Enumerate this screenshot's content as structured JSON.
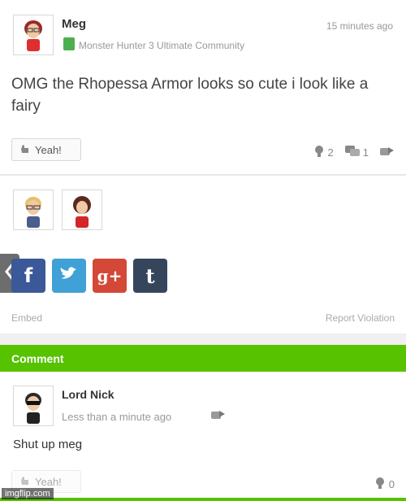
{
  "post": {
    "author": "Meg",
    "time": "15 minutes ago",
    "community": "Monster Hunter 3 Ultimate Community",
    "text": "OMG the Rhopessa Armor looks so cute i look like a fairy",
    "yeah_label": "Yeah!",
    "yeah_count": "2",
    "comment_count": "1"
  },
  "share": {
    "facebook": "f",
    "twitter": "t",
    "googleplus": "g+",
    "tumblr": "t"
  },
  "links": {
    "embed": "Embed",
    "report": "Report Violation"
  },
  "comments_header": "Comment",
  "comment": {
    "author": "Lord Nick",
    "time": "Less than a minute ago",
    "text": "Shut up meg",
    "yeah_label": "Yeah!",
    "yeah_count": "0"
  },
  "watermark": "imgflip.com",
  "colors": {
    "accent_green": "#56c200",
    "facebook": "#3b5998",
    "twitter": "#3fa1d6",
    "googleplus": "#d34836",
    "tumblr": "#35465c"
  }
}
